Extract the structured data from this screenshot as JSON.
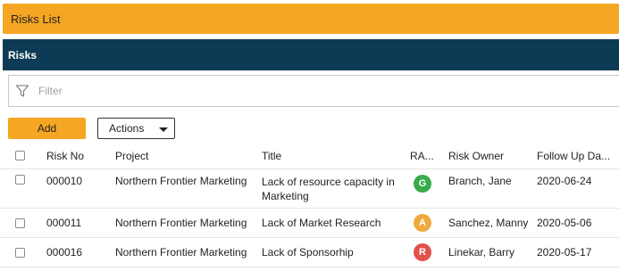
{
  "page": {
    "title": "Risks List"
  },
  "panel": {
    "header": "Risks"
  },
  "filter": {
    "placeholder": "Filter",
    "icon": "filter-icon"
  },
  "toolbar": {
    "add_label": "Add",
    "actions_label": "Actions"
  },
  "table": {
    "columns": {
      "risk_no": "Risk No",
      "project": "Project",
      "title": "Title",
      "rag": "RA...",
      "owner": "Risk Owner",
      "follow_up": "Follow Up Da..."
    },
    "rows": [
      {
        "risk_no": "000010",
        "project": "Northern Frontier Marketing",
        "title": "Lack of resource capacity in Marketing",
        "rag": "G",
        "rag_color": "#3aaa4a",
        "owner": "Branch, Jane",
        "follow_up": "2020-06-24"
      },
      {
        "risk_no": "000011",
        "project": "Northern Frontier Marketing",
        "title": "Lack of Market Research",
        "rag": "A",
        "rag_color": "#efaa3e",
        "owner": "Sanchez, Manny",
        "follow_up": "2020-05-06"
      },
      {
        "risk_no": "000016",
        "project": "Northern Frontier Marketing",
        "title": "Lack of Sponsorhip",
        "rag": "R",
        "rag_color": "#e0524c",
        "owner": "Linekar, Barry",
        "follow_up": "2020-05-17"
      }
    ]
  },
  "colors": {
    "accent": "#f5a623",
    "header_bg": "#0d3b55"
  }
}
